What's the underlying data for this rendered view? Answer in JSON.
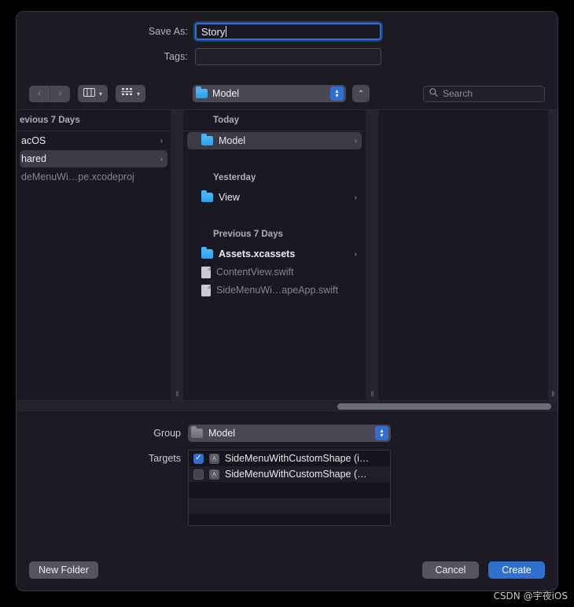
{
  "dialog": {
    "save_as_label": "Save As:",
    "save_as_value": "Story",
    "tags_label": "Tags:",
    "tags_placeholder": ""
  },
  "toolbar": {
    "back_icon": "‹",
    "forward_icon": "›",
    "view_columns_icon": "▐▕",
    "view_group_icon": "∷",
    "chevron_down_icon": "▾",
    "path_label": "Model",
    "stepper_up_icon": "▴",
    "stepper_down_icon": "▾",
    "up_button_icon": "⌃",
    "search_icon": "⌕",
    "search_placeholder": "Search"
  },
  "browser": {
    "left_column": {
      "header": "evious 7 Days",
      "items": [
        {
          "name": "acOS",
          "type": "folder",
          "disclosure": "›",
          "selected": false,
          "dim": false
        },
        {
          "name": "hared",
          "type": "folder",
          "disclosure": "›",
          "selected": true,
          "dim": false
        },
        {
          "name": "deMenuWi…pe.xcodeproj",
          "type": "doc",
          "disclosure": "",
          "selected": false,
          "dim": true
        }
      ]
    },
    "middle_column": {
      "groups": [
        {
          "header": "Today",
          "items": [
            {
              "name": "Model",
              "type": "folder",
              "disclosure": "›",
              "selected": true,
              "bold": false,
              "dim": false
            }
          ]
        },
        {
          "header": "Yesterday",
          "items": [
            {
              "name": "View",
              "type": "folder",
              "disclosure": "›",
              "selected": false,
              "bold": false,
              "dim": false
            }
          ]
        },
        {
          "header": "Previous 7 Days",
          "items": [
            {
              "name": "Assets.xcassets",
              "type": "folder",
              "disclosure": "›",
              "selected": false,
              "bold": true,
              "dim": false
            },
            {
              "name": "ContentView.swift",
              "type": "doc",
              "disclosure": "",
              "selected": false,
              "bold": false,
              "dim": true
            },
            {
              "name": "SideMenuWi…apeApp.swift",
              "type": "doc",
              "disclosure": "",
              "selected": false,
              "bold": false,
              "dim": true
            }
          ]
        }
      ]
    },
    "right_column": {
      "items": []
    },
    "resize_grip_icon": "‖"
  },
  "accessory": {
    "group_label": "Group",
    "group_value": "Model",
    "targets_label": "Targets",
    "targets": [
      {
        "name": "SideMenuWithCustomShape (i…",
        "checked": true,
        "icon": "Ⓐ"
      },
      {
        "name": "SideMenuWithCustomShape (…",
        "checked": false,
        "icon": "Ⓐ"
      }
    ]
  },
  "footer": {
    "new_folder_label": "New Folder",
    "cancel_label": "Cancel",
    "create_label": "Create"
  },
  "watermark": {
    "text": "CSDN @宇夜iOS"
  },
  "colors": {
    "accent": "#2f6fd0",
    "window_bg": "#1c1a23",
    "browser_bg": "#1a1822",
    "control_bg": "#4a4854",
    "selected_row": "#3d3a46"
  }
}
